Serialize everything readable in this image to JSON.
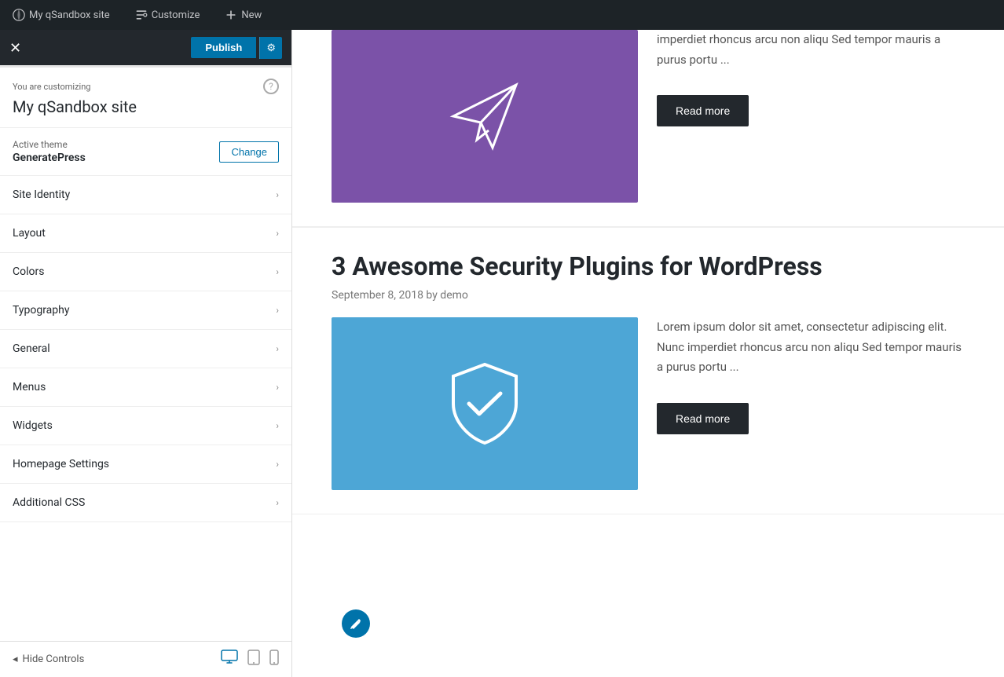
{
  "adminBar": {
    "items": [
      {
        "id": "my-site",
        "label": "My qSandbox site",
        "icon": "site-icon"
      },
      {
        "id": "customize",
        "label": "Customize",
        "icon": "customize-icon"
      },
      {
        "id": "new",
        "label": "New",
        "icon": "plus-icon"
      }
    ]
  },
  "customizer": {
    "closeLabel": "✕",
    "publishLabel": "Publish",
    "settingsIcon": "⚙",
    "customizingLabel": "You are customizing",
    "siteName": "My qSandbox site",
    "helpLabel": "?",
    "activeThemeLabel": "Active theme",
    "themeName": "GeneratePress",
    "changeLabel": "Change",
    "navItems": [
      {
        "id": "site-identity",
        "label": "Site Identity"
      },
      {
        "id": "layout",
        "label": "Layout"
      },
      {
        "id": "colors",
        "label": "Colors"
      },
      {
        "id": "typography",
        "label": "Typography"
      },
      {
        "id": "general",
        "label": "General"
      },
      {
        "id": "menus",
        "label": "Menus"
      },
      {
        "id": "widgets",
        "label": "Widgets"
      },
      {
        "id": "homepage-settings",
        "label": "Homepage Settings"
      },
      {
        "id": "additional-css",
        "label": "Additional CSS"
      }
    ],
    "footer": {
      "hideControlsLabel": "Hide Controls",
      "deviceDesktopLabel": "Desktop",
      "deviceTabletLabel": "Tablet",
      "deviceMobileLabel": "Mobile"
    }
  },
  "preview": {
    "partialPost": {
      "excerpt": "imperdiet rhoncus arcu non aliqu Sed tempor mauris a purus portu ...",
      "readMoreLabel": "Read more"
    },
    "posts": [
      {
        "id": "post1",
        "title": "3 Awesome Security Plugins for WordPress",
        "meta": "September 8, 2018 by demo",
        "excerpt": "Lorem ipsum dolor sit amet, consectetur adipiscing elit. Nunc imperdiet rhoncus arcu non aliqu Sed tempor mauris a purus portu ...",
        "readMoreLabel": "Read more",
        "imageColor": "blue",
        "imageIcon": "shield"
      }
    ]
  }
}
